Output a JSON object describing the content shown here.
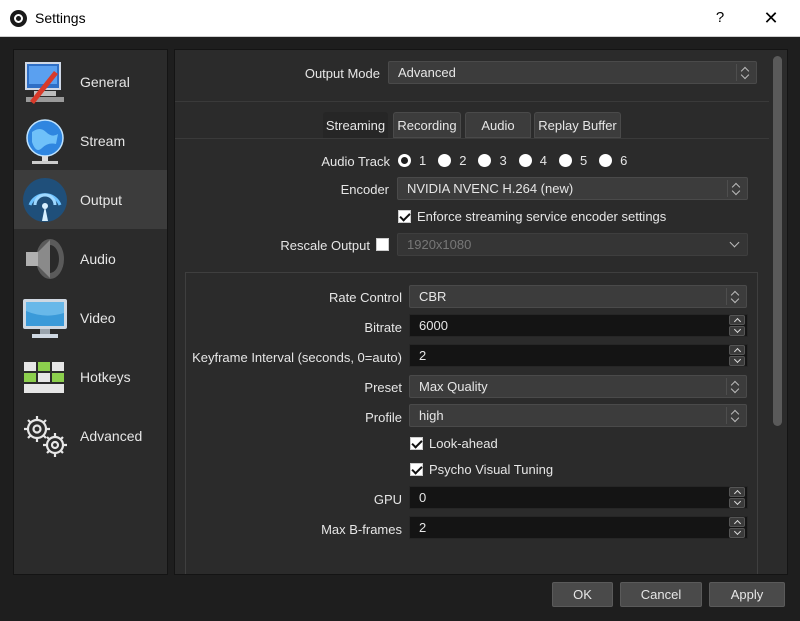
{
  "window": {
    "title": "Settings",
    "help_label": "?",
    "close_label": "✕"
  },
  "sidebar": {
    "items": [
      {
        "label": "General",
        "icon": "general-icon",
        "active": false
      },
      {
        "label": "Stream",
        "icon": "globe-icon",
        "active": false
      },
      {
        "label": "Output",
        "icon": "output-icon",
        "active": true
      },
      {
        "label": "Audio",
        "icon": "speaker-icon",
        "active": false
      },
      {
        "label": "Video",
        "icon": "monitor-icon",
        "active": false
      },
      {
        "label": "Hotkeys",
        "icon": "keyboard-icon",
        "active": false
      },
      {
        "label": "Advanced",
        "icon": "gears-icon",
        "active": false
      }
    ]
  },
  "output_mode": {
    "label": "Output Mode",
    "value": "Advanced"
  },
  "tabs": [
    {
      "label": "Streaming",
      "active": true
    },
    {
      "label": "Recording",
      "active": false
    },
    {
      "label": "Audio",
      "active": false
    },
    {
      "label": "Replay Buffer",
      "active": false
    }
  ],
  "audio_track": {
    "label": "Audio Track",
    "options": [
      "1",
      "2",
      "3",
      "4",
      "5",
      "6"
    ],
    "selected": "1"
  },
  "encoder": {
    "label": "Encoder",
    "value": "NVIDIA NVENC H.264 (new)"
  },
  "enforce": {
    "label": "Enforce streaming service encoder settings",
    "checked": true
  },
  "rescale": {
    "label": "Rescale Output",
    "checked": false,
    "value": "1920x1080"
  },
  "encoder_settings": {
    "rate_control": {
      "label": "Rate Control",
      "value": "CBR"
    },
    "bitrate": {
      "label": "Bitrate",
      "value": "6000"
    },
    "keyframe": {
      "label": "Keyframe Interval (seconds, 0=auto)",
      "value": "2"
    },
    "preset": {
      "label": "Preset",
      "value": "Max Quality"
    },
    "profile": {
      "label": "Profile",
      "value": "high"
    },
    "lookahead": {
      "label": "Look-ahead",
      "checked": true
    },
    "psycho": {
      "label": "Psycho Visual Tuning",
      "checked": true
    },
    "gpu": {
      "label": "GPU",
      "value": "0"
    },
    "bframes": {
      "label": "Max B-frames",
      "value": "2"
    }
  },
  "buttons": {
    "ok": "OK",
    "cancel": "Cancel",
    "apply": "Apply"
  }
}
